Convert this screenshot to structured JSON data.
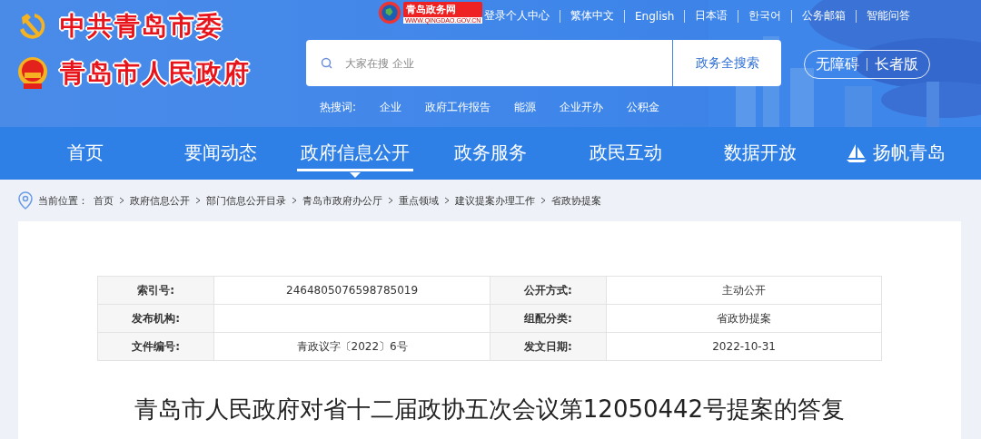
{
  "header": {
    "party_title": "中共青岛市委",
    "gov_title": "青岛市人民政府",
    "site_logo": {
      "name": "青岛政务网",
      "url": "WWW.QINGDAO.GOV.CN"
    },
    "top_links": [
      "登录个人中心",
      "繁体中文",
      "English",
      "日本语",
      "한국어",
      "公务邮箱",
      "智能问答"
    ],
    "search": {
      "placeholder": "大家在搜 企业",
      "button": "政务全搜索"
    },
    "accessibility": [
      "无障碍",
      "长者版"
    ],
    "hot_label": "热搜词:",
    "hot_words": [
      "企业",
      "政府工作报告",
      "能源",
      "企业开办",
      "公积金"
    ]
  },
  "nav": [
    {
      "label": "首页",
      "selected": false,
      "kind": "plain"
    },
    {
      "label": "要闻动态",
      "selected": false,
      "kind": "plain"
    },
    {
      "label": "政府信息公开",
      "selected": true,
      "kind": "plain"
    },
    {
      "label": "政务服务",
      "selected": false,
      "kind": "plain"
    },
    {
      "label": "政民互动",
      "selected": false,
      "kind": "plain"
    },
    {
      "label": "数据开放",
      "selected": false,
      "kind": "plain"
    },
    {
      "label": "扬帆青岛",
      "selected": false,
      "kind": "sail"
    }
  ],
  "breadcrumb": {
    "label": "当前位置：",
    "items": [
      "首页",
      "政府信息公开",
      "部门信息公开目录",
      "青岛市政府办公厅",
      "重点领域",
      "建议提案办理工作",
      "省政协提案"
    ]
  },
  "info_table": [
    {
      "label": "索引号:",
      "value": "2464805076598785019",
      "label_2": "公开方式:",
      "value_2": "主动公开"
    },
    {
      "label": "发布机构:",
      "label_2": "组配分类:",
      "value_2": "省政协提案"
    },
    {
      "label": "文件编号:",
      "value": "青政议字〔2022〕6号",
      "label_2": "发文日期:",
      "value_2": "2022-10-31"
    }
  ],
  "title": "青岛市人民政府对省十二届政协五次会议第12050442号提案的答复"
}
